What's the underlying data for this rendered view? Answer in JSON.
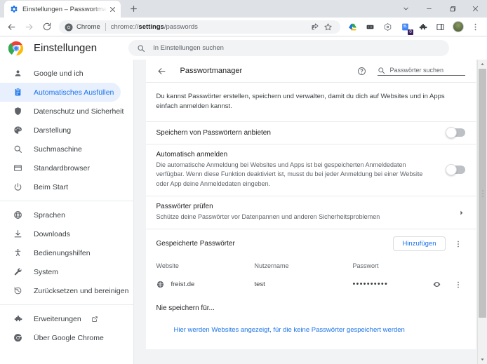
{
  "window": {
    "controls": {
      "tab_search": "tab-search-chevron",
      "minimize": "minimize",
      "maximize": "maximize",
      "close": "close"
    }
  },
  "tabstrip": {
    "tab": {
      "title": "Einstellungen – Passwortmanager",
      "favicon": "settings-gear-icon",
      "close_label": "✕"
    },
    "new_tab_label": "+"
  },
  "toolbar": {
    "back": "back-arrow",
    "forward": "forward-arrow",
    "reload": "reload-icon",
    "omnibox": {
      "scheme_label": "Chrome",
      "url_prefix": "chrome://",
      "url_bold": "settings",
      "url_suffix": "/passwords"
    },
    "icons": [
      "share-icon",
      "bookmark-star-icon",
      "google-drive-icon",
      "extension-dark-icon",
      "extension-gray-icon",
      "extension-badge-icon",
      "puzzle-extensions-icon",
      "side-panel-icon"
    ],
    "extension_badge_count": "0",
    "profile_avatar": "profile-avatar",
    "menu": "three-dot-menu"
  },
  "settings_header": {
    "logo": "chrome-logo",
    "title": "Einstellungen",
    "search_placeholder": "In Einstellungen suchen"
  },
  "sidebar": {
    "items": [
      {
        "label": "Google und ich",
        "icon": "person-icon",
        "active": false
      },
      {
        "label": "Automatisches Ausfüllen",
        "icon": "clipboard-icon",
        "active": true
      },
      {
        "label": "Datenschutz und Sicherheit",
        "icon": "shield-icon",
        "active": false
      },
      {
        "label": "Darstellung",
        "icon": "palette-icon",
        "active": false
      },
      {
        "label": "Suchmaschine",
        "icon": "search-icon",
        "active": false
      },
      {
        "label": "Standardbrowser",
        "icon": "browser-window-icon",
        "active": false
      },
      {
        "label": "Beim Start",
        "icon": "power-icon",
        "active": false
      }
    ],
    "items2": [
      {
        "label": "Sprachen",
        "icon": "globe-icon",
        "active": false
      },
      {
        "label": "Downloads",
        "icon": "download-icon",
        "active": false
      },
      {
        "label": "Bedienungshilfen",
        "icon": "accessibility-icon",
        "active": false
      },
      {
        "label": "System",
        "icon": "wrench-icon",
        "active": false
      },
      {
        "label": "Zurücksetzen und bereinigen",
        "icon": "history-restore-icon",
        "active": false
      }
    ],
    "items3": [
      {
        "label": "Erweiterungen",
        "icon": "puzzle-icon",
        "external": true
      },
      {
        "label": "Über Google Chrome",
        "icon": "chrome-outline-icon",
        "external": false
      }
    ]
  },
  "main": {
    "page_title": "Passwortmanager",
    "back_icon": "back-arrow-icon",
    "help_icon": "help-circle-icon",
    "search_placeholder": "Passwörter suchen",
    "intro": "Du kannst Passwörter erstellen, speichern und verwalten, damit du dich auf Websites und in Apps einfach anmelden kannst.",
    "offer_save": {
      "title": "Speichern von Passwörtern anbieten",
      "toggle_on": false
    },
    "auto_signin": {
      "title": "Automatisch anmelden",
      "description": "Die automatische Anmeldung bei Websites und Apps ist bei gespeicherten Anmeldedaten verfügbar. Wenn diese Funktion deaktiviert ist, musst du bei jeder Anmeldung bei einer Website oder App deine Anmeldedaten eingeben.",
      "toggle_on": false
    },
    "check_passwords": {
      "title": "Passwörter prüfen",
      "description": "Schütze deine Passwörter vor Datenpannen und anderen Sicherheitsproblemen",
      "chevron": "chevron-right-icon"
    },
    "saved_passwords": {
      "label": "Gespeicherte Passwörter",
      "add_button": "Hinzufügen",
      "menu_icon": "three-dot-menu-icon",
      "columns": [
        "Website",
        "Nutzername",
        "Passwort"
      ],
      "rows": [
        {
          "site": "freist.de",
          "favicon": "globe-favicon",
          "username": "test",
          "password_mask": "••••••••••",
          "show_icon": "eye-icon",
          "menu_icon": "three-dot-menu-icon"
        }
      ]
    },
    "never_saved": {
      "title": "Nie speichern für...",
      "empty_text": "Hier werden Websites angezeigt, für die keine Passwörter gespeichert werden"
    }
  },
  "colors": {
    "accent": "#1a73e8",
    "active_bg": "#e8f0fe",
    "text_primary": "#202124",
    "text_secondary": "#5f6368",
    "tabstrip_bg": "#dee1e6",
    "page_bg": "#f1f3f4"
  }
}
